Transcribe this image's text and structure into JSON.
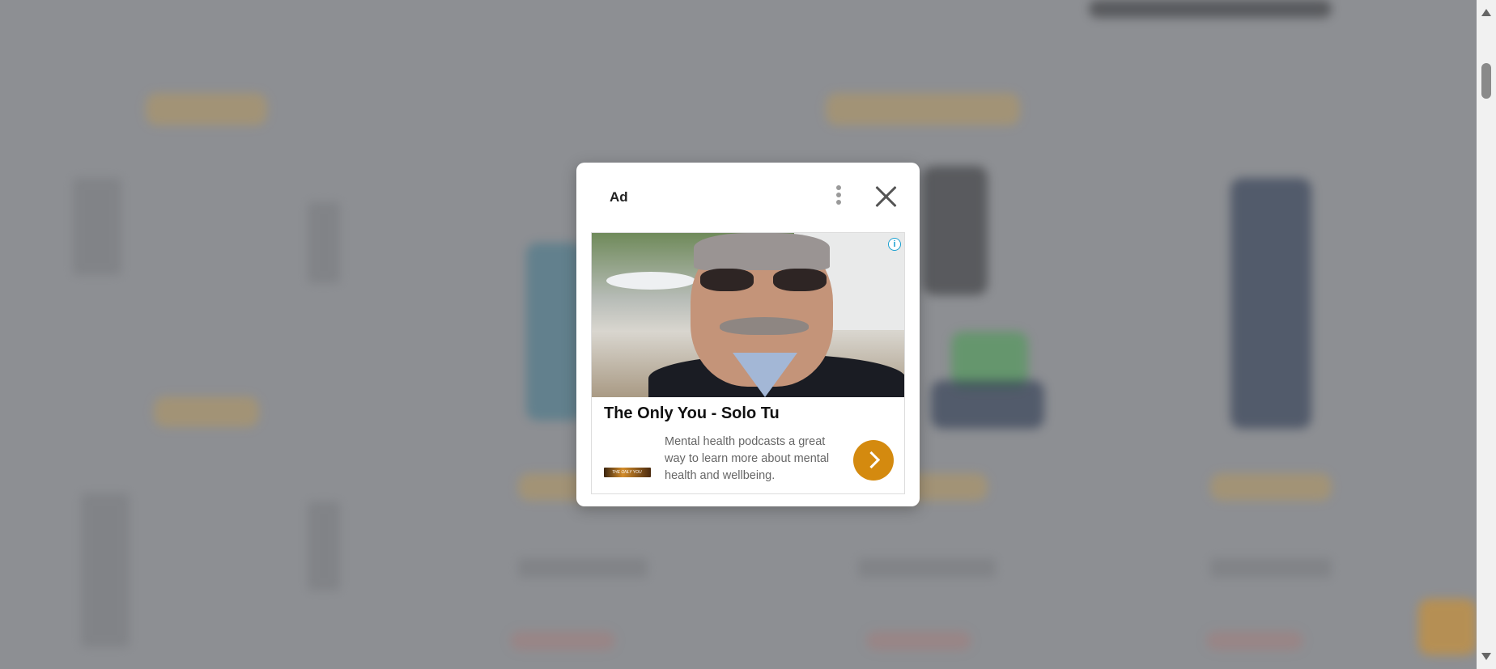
{
  "ad": {
    "label": "Ad",
    "headline": "The Only You - Solo Tu",
    "description": "Mental health podcasts a great way to learn more about mental health and wellbeing.",
    "logo_text": "THE ONLY YOU",
    "adchoices_glyph": "i",
    "cta_color": "#d48a0f"
  },
  "icons": {
    "menu": "vertical-dots-icon",
    "close": "close-icon",
    "adchoices": "info-icon",
    "cta": "chevron-right-icon"
  },
  "colors": {
    "overlay": "#8d8f93",
    "accent": "#d48a0f"
  }
}
